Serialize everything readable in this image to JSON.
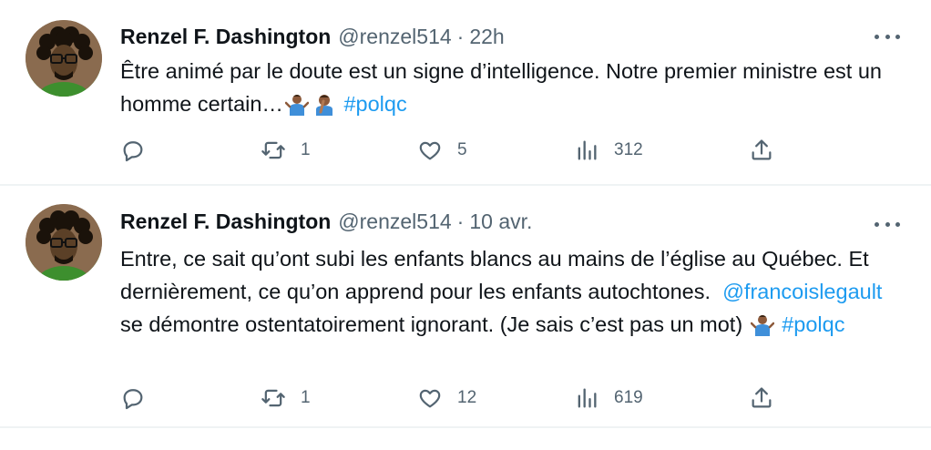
{
  "tweets": [
    {
      "author": "Renzel F. Dashington",
      "handle": "@renzel514",
      "separator": "·",
      "time": "22h",
      "text_part1": "Être animé par le doute est un signe d’intelligence. Notre premier ministre est un homme certain…",
      "emojis": [
        "person-shrugging-emoji",
        "person-facepalming-emoji"
      ],
      "hashtag": "#polqc",
      "reply_count": "",
      "retweet_count": "1",
      "like_count": "5",
      "view_count": "312"
    },
    {
      "author": "Renzel F. Dashington",
      "handle": "@renzel514",
      "separator": "·",
      "time": "10 avr.",
      "text_part1": "Entre, ce sait qu’ont subi les enfants blancs au mains de l’église au Québec. Et dernièrement, ce qu’on apprend pour les enfants autochtones.",
      "mention": "@francoislegault",
      "text_part2": " se démontre ostentatoirement ignorant. (Je sais c’est pas un mot)",
      "emojis": [
        "person-shrugging-emoji"
      ],
      "hashtag": "#polqc",
      "reply_count": "",
      "retweet_count": "1",
      "like_count": "12",
      "view_count": "619"
    }
  ],
  "colors": {
    "text": "#0f1419",
    "secondary": "#536471",
    "link": "#1d9bf0",
    "divider": "#eff3f4"
  },
  "icons": [
    "reply-icon",
    "retweet-icon",
    "like-icon",
    "views-icon",
    "share-icon",
    "more-options-icon"
  ]
}
